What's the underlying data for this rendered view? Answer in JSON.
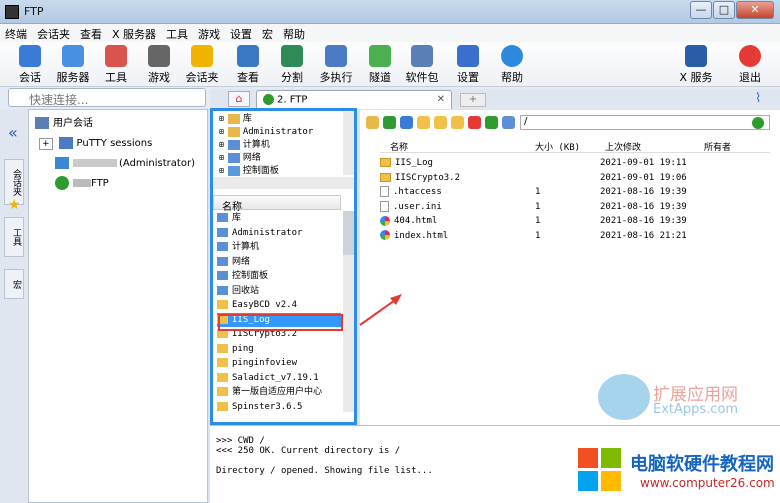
{
  "window": {
    "title": "FTP",
    "min": "—",
    "max": "□",
    "close": "✕"
  },
  "menu": [
    "终端",
    "会话夹",
    "查看",
    "X 服务器",
    "工具",
    "游戏",
    "设置",
    "宏",
    "帮助"
  ],
  "toolbar": [
    {
      "label": "会话",
      "icon": "session-icon",
      "color": "#3a7bd5"
    },
    {
      "label": "服务器",
      "icon": "servers-icon",
      "color": "#4a90e2"
    },
    {
      "label": "工具",
      "icon": "tools-icon",
      "color": "#d9534f"
    },
    {
      "label": "游戏",
      "icon": "games-icon",
      "color": "#666666"
    },
    {
      "label": "会话夹",
      "icon": "star-icon",
      "color": "#f0b400"
    },
    {
      "label": "查看",
      "icon": "view-icon",
      "color": "#3b78c4"
    },
    {
      "label": "分割",
      "icon": "split-icon",
      "color": "#2e8b57"
    },
    {
      "label": "多执行",
      "icon": "multiexec-icon",
      "color": "#4a7bc4"
    },
    {
      "label": "隧道",
      "icon": "tunnel-icon",
      "color": "#4caf50"
    },
    {
      "label": "软件包",
      "icon": "package-icon",
      "color": "#5a7fb6"
    },
    {
      "label": "设置",
      "icon": "gear-icon",
      "color": "#3a6fd0"
    },
    {
      "label": "帮助",
      "icon": "help-icon",
      "color": "#2d89e0"
    },
    {
      "label": "X 服务器",
      "icon": "xserver-icon",
      "color": "#2a5da8"
    },
    {
      "label": "退出",
      "icon": "power-icon",
      "color": "#e53935"
    }
  ],
  "quick": {
    "placeholder": "快速连接..."
  },
  "left": {
    "root": "用户会话",
    "items": [
      "PuTTY sessions",
      "(Administrator)",
      "FTP"
    ]
  },
  "vtabs": [
    "会话夹",
    "工具",
    "宏"
  ],
  "tabs": {
    "active": "2.   FTP"
  },
  "local_tree": [
    "库",
    "Administrator",
    "计算机",
    "网络",
    "控制面板"
  ],
  "local_list_header": "名称",
  "local_list": [
    "库",
    "Administrator",
    "计算机",
    "网络",
    "控制面板",
    "回收站",
    "EasyBCD v2.4",
    "IIS_Log",
    "IISCrypto3.2",
    "ping",
    "pinginfoview",
    "Saladict_v7.19.1",
    "第一版自适应用户中心",
    "Spinster3.6.5"
  ],
  "remote": {
    "path": "/",
    "headers": [
      "名称",
      "大小 (KB)",
      "上次修改",
      "所有者"
    ],
    "files": [
      {
        "name": "IIS_Log",
        "size": "",
        "date": "2021-09-01 19:11",
        "type": "folder"
      },
      {
        "name": "IISCrypto3.2",
        "size": "",
        "date": "2021-09-01 19:06",
        "type": "folder"
      },
      {
        "name": ".htaccess",
        "size": "1",
        "date": "2021-08-16 19:39",
        "type": "file"
      },
      {
        "name": ".user.ini",
        "size": "1",
        "date": "2021-08-16 19:39",
        "type": "file"
      },
      {
        "name": "404.html",
        "size": "1",
        "date": "2021-08-16 19:39",
        "type": "web"
      },
      {
        "name": "index.html",
        "size": "1",
        "date": "2021-08-16 21:21",
        "type": "web"
      }
    ]
  },
  "log": [
    ">>>  CWD /",
    "<<<  250 OK. Current directory is /",
    "",
    "Directory / opened. Showing file list..."
  ],
  "watermark1": {
    "line1": "扩展应用网",
    "line2": "ExtApps.com"
  },
  "watermark2": {
    "line1": "电脑软硬件教程网",
    "line2": "www.computer26.com"
  }
}
